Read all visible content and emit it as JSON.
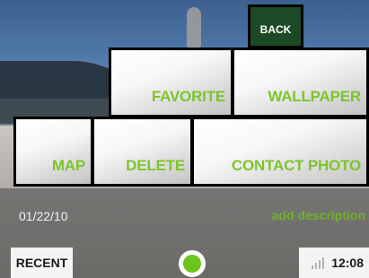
{
  "header": {
    "back_label": "BACK"
  },
  "actions": {
    "favorite": "FAVORITE",
    "wallpaper": "WALLPAPER",
    "map": "MAP",
    "delete": "DELETE",
    "contact_photo": "CONTACT PHOTO"
  },
  "photo_info": {
    "date": "01/22/10",
    "add_description": "add description"
  },
  "bottom_bar": {
    "recent_label": "RECENT",
    "time": "12:08",
    "signal_icon": "signal-bars-icon",
    "home_icon": "home-dot-icon"
  },
  "colors": {
    "accent": "#7cc52a",
    "back_tile": "#1d4a26",
    "home_dot": "#6bc51f"
  }
}
